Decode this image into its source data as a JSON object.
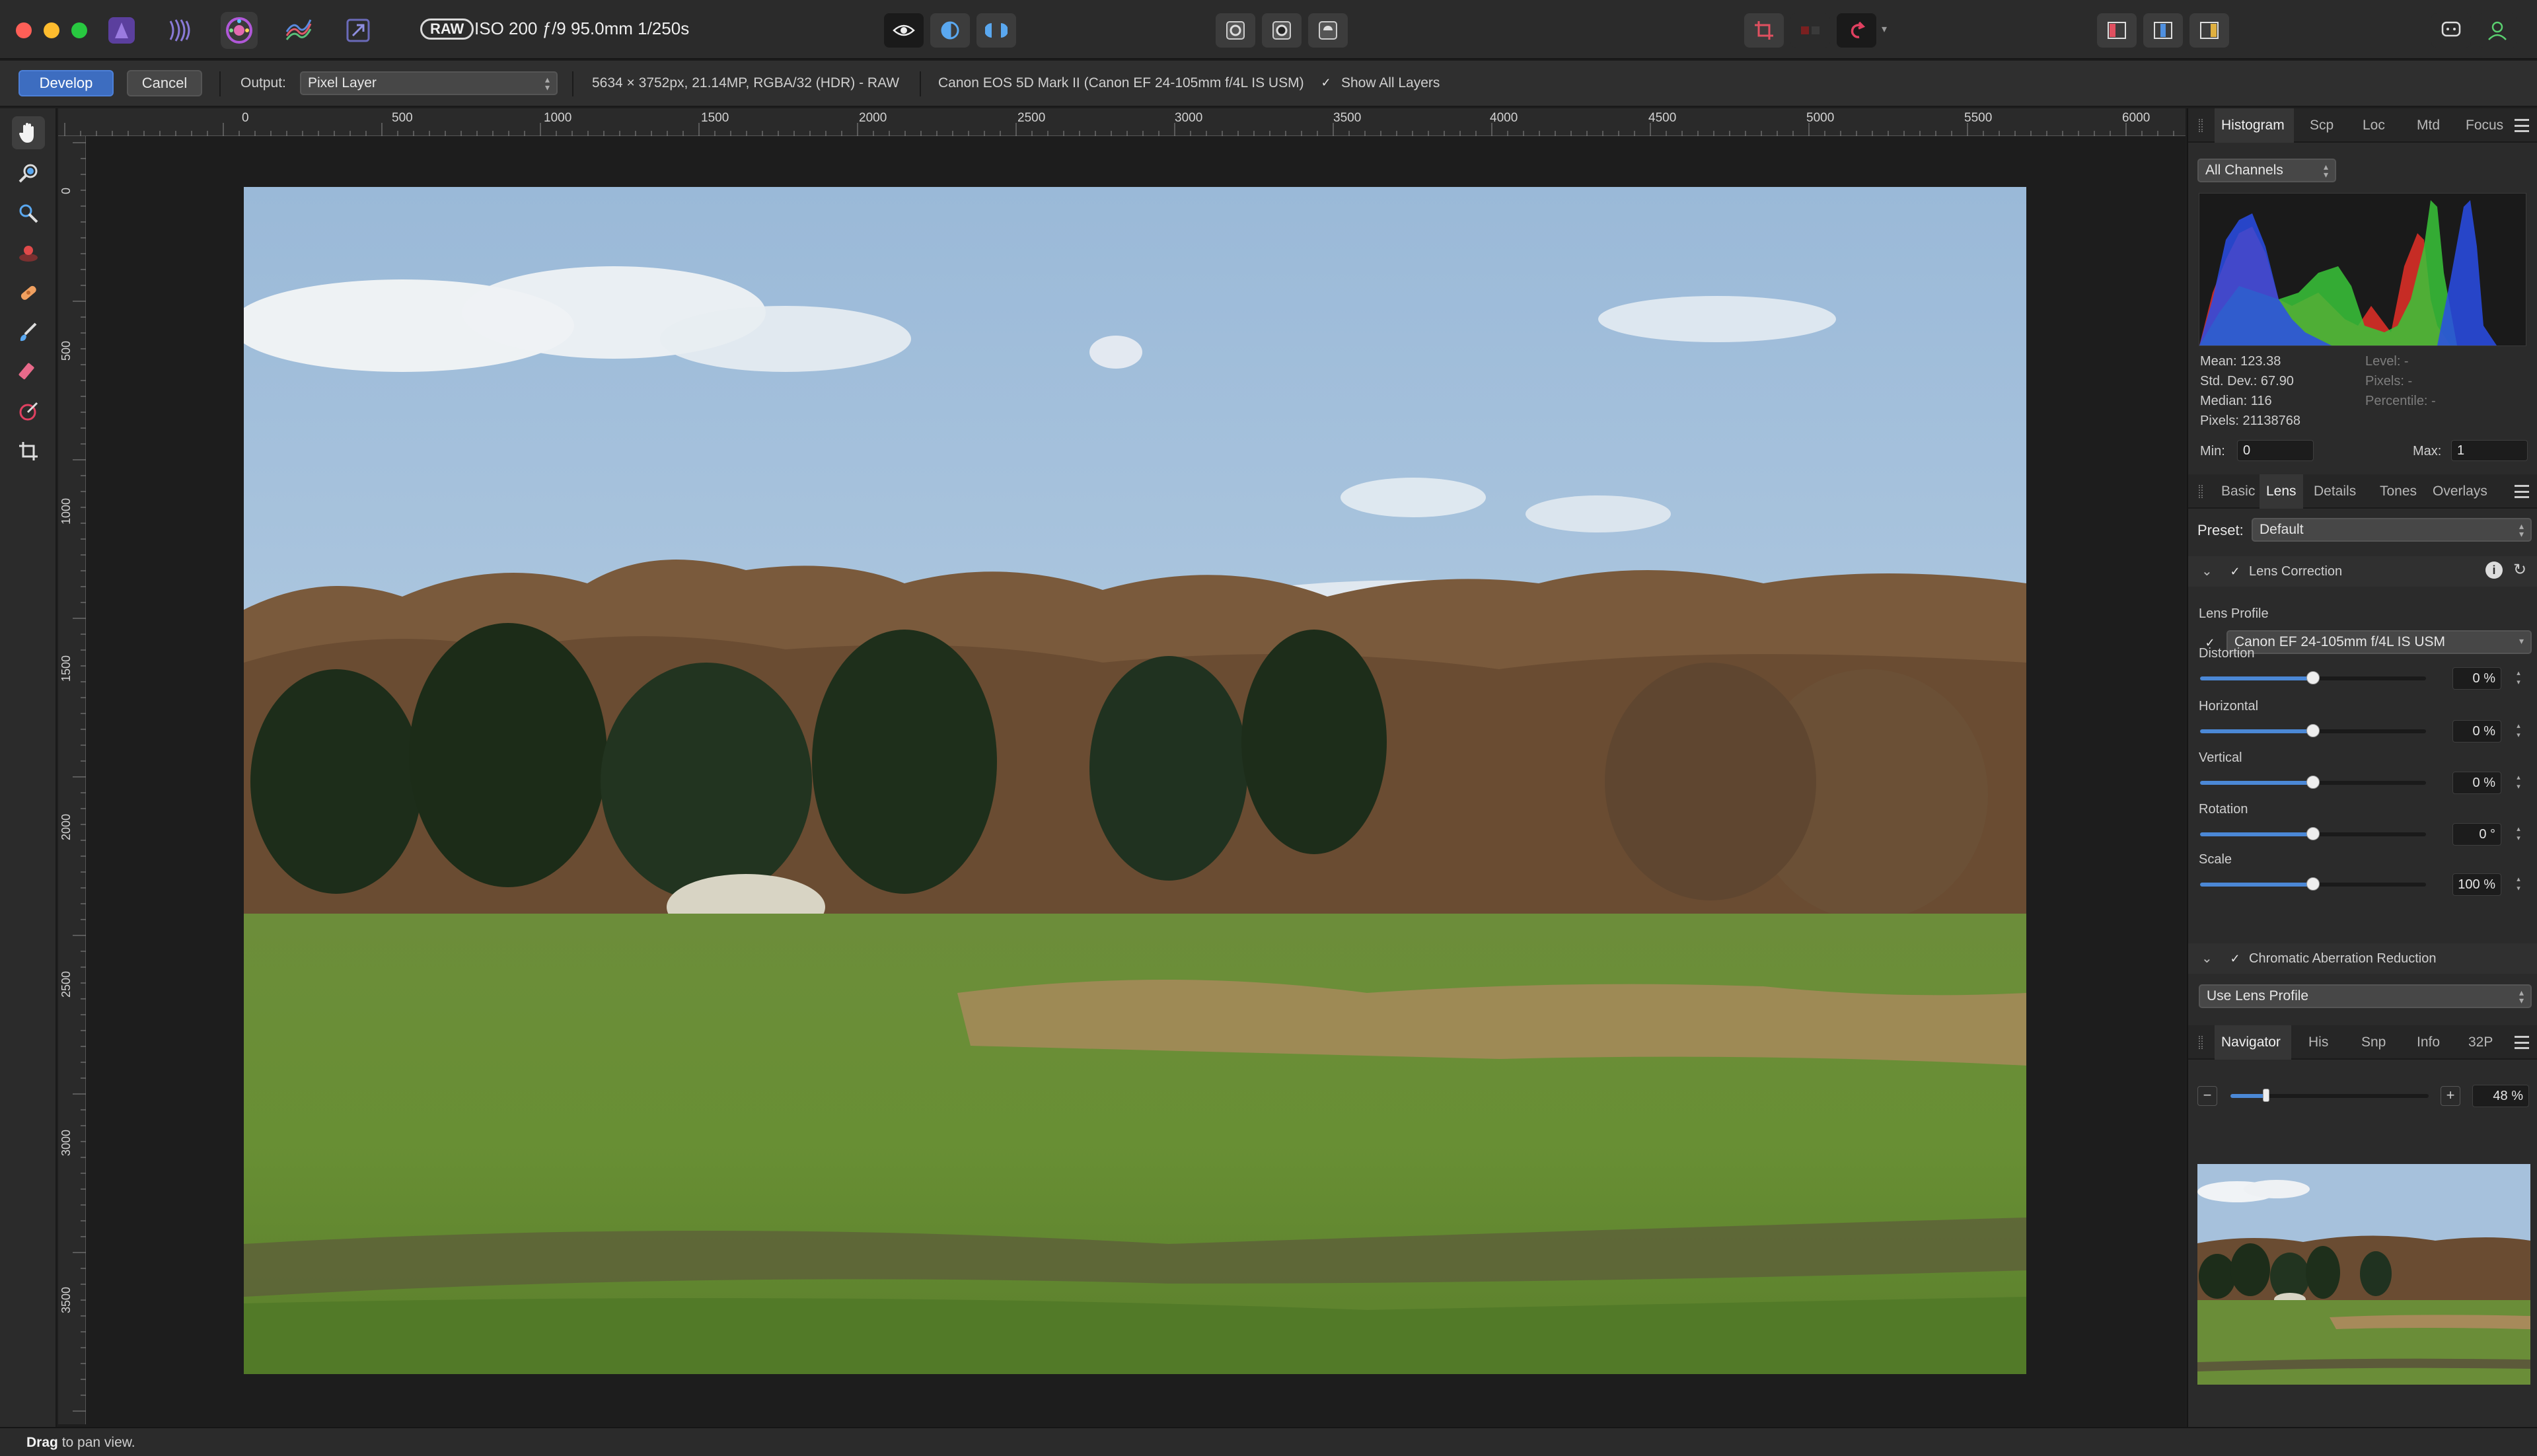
{
  "titlebar": {
    "raw_badge": "RAW",
    "exif": "ISO 200 ƒ/9 95.0mm 1/250s",
    "personas": [
      "photo-persona",
      "liquify-persona",
      "develop-persona",
      "tone-mapping-persona",
      "export-persona"
    ],
    "active_persona": "develop-persona"
  },
  "context": {
    "develop_label": "Develop",
    "cancel_label": "Cancel",
    "output_label": "Output:",
    "output_value": "Pixel Layer",
    "image_info": "5634 × 3752px, 21.14MP, RGBA/32 (HDR) - RAW",
    "camera_info": "Canon EOS 5D Mark II (Canon EF 24-105mm f/4L IS USM)",
    "show_all_layers_label": "Show All Layers",
    "show_all_layers_checked": true
  },
  "rulers": {
    "unit": "px",
    "top_labels": [
      "0",
      "500",
      "1000",
      "1500",
      "2000",
      "2500",
      "3000",
      "3500",
      "4000",
      "4500",
      "5000",
      "5500",
      "6000"
    ],
    "left_labels": [
      "0",
      "500",
      "1000",
      "1500",
      "2000",
      "2500",
      "3000",
      "3500"
    ]
  },
  "histogram_panel": {
    "tabs": [
      "Histogram",
      "Scp",
      "Loc",
      "Mtd",
      "Focus"
    ],
    "active_tab": "Histogram",
    "channel": "All Channels",
    "mean": "Mean: 123.38",
    "std_dev": "Std. Dev.: 67.90",
    "median": "Median: 116",
    "pixels": "Pixels: 21138768",
    "level": "Level: -",
    "pixels_sel": "Pixels: -",
    "percentile": "Percentile: -",
    "min_label": "Min:",
    "min_value": "0",
    "max_label": "Max:",
    "max_value": "1"
  },
  "develop_panel": {
    "tabs": [
      "Basic",
      "Lens",
      "Details",
      "Tones",
      "Overlays"
    ],
    "active_tab": "Lens",
    "preset_label": "Preset:",
    "preset_value": "Default",
    "lens_correction_label": "Lens Correction",
    "lens_profile_label": "Lens Profile",
    "lens_profile_value": "Canon EF 24-105mm f/4L IS USM",
    "sliders": [
      {
        "label": "Distortion",
        "value": "0 %",
        "position": 0.5
      },
      {
        "label": "Horizontal",
        "value": "0 %",
        "position": 0.5
      },
      {
        "label": "Vertical",
        "value": "0 %",
        "position": 0.5
      },
      {
        "label": "Rotation",
        "value": "0 °",
        "position": 0.5
      },
      {
        "label": "Scale",
        "value": "100 %",
        "position": 0.5
      }
    ],
    "chromatic_label": "Chromatic Aberration Reduction",
    "chromatic_value": "Use Lens Profile"
  },
  "navigator_panel": {
    "tabs": [
      "Navigator",
      "His",
      "Snp",
      "Info",
      "32P"
    ],
    "active_tab": "Navigator",
    "zoom_value": "48 %",
    "zoom_position": 0.18
  },
  "status": {
    "bold": "Drag",
    "text": " to pan view."
  },
  "colors": {
    "accent": "#3d6dc0",
    "slider_fill": "#4b88d6",
    "panel_bg": "#2b2b2b",
    "canvas_bg": "#1d1d1d"
  }
}
